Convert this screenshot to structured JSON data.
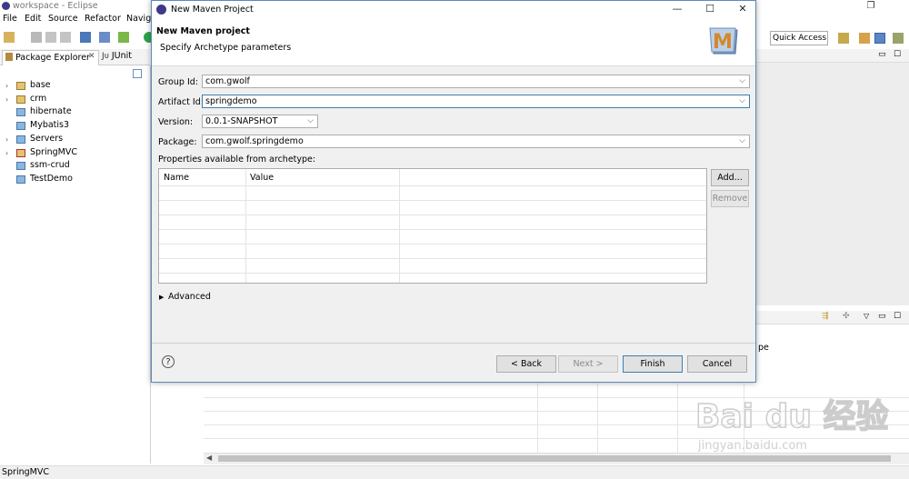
{
  "window": {
    "title": "workspace - Eclipse",
    "controls": {
      "minimize": "—",
      "restore": "❐"
    }
  },
  "menu": [
    "File",
    "Edit",
    "Source",
    "Refactor",
    "Navig"
  ],
  "quick_access": "Quick Access",
  "views": {
    "package_explorer_tab": "Package Explorer",
    "junit_tab": "JUnit",
    "tree": [
      {
        "label": "base",
        "icon": "java-project-icon",
        "expander": true
      },
      {
        "label": "crm",
        "icon": "java-project-icon",
        "expander": true
      },
      {
        "label": "hibernate",
        "icon": "folder-icon",
        "expander": false
      },
      {
        "label": "Mybatis3",
        "icon": "folder-icon",
        "expander": false
      },
      {
        "label": "Servers",
        "icon": "folder-icon",
        "expander": true
      },
      {
        "label": "SpringMVC",
        "icon": "error-project-icon",
        "expander": true
      },
      {
        "label": "ssm-crud",
        "icon": "folder-icon",
        "expander": false
      },
      {
        "label": "TestDemo",
        "icon": "folder-icon",
        "expander": false
      }
    ],
    "right_partial_text": "pe"
  },
  "status_bar": {
    "text": "SpringMVC"
  },
  "dialog": {
    "title": "New Maven Project",
    "header_title": "New Maven project",
    "header_desc": "Specify Archetype parameters",
    "fields": {
      "group_id_label": "Group Id:",
      "group_id_value": "com.gwolf",
      "artifact_id_label": "Artifact Id:",
      "artifact_id_value": "springdemo",
      "version_label": "Version:",
      "version_value": "0.0.1-SNAPSHOT",
      "package_label": "Package:",
      "package_value": "com.gwolf.springdemo"
    },
    "properties_label": "Properties available from archetype:",
    "table_headers": [
      "Name",
      "Value"
    ],
    "buttons": {
      "add": "Add...",
      "remove": "Remove",
      "back": "< Back",
      "next": "Next >",
      "finish": "Finish",
      "cancel": "Cancel"
    },
    "advanced_label": "Advanced",
    "help_symbol": "?"
  },
  "watermark": {
    "brand": "Bai du 经验",
    "url": "jingyan.baidu.com"
  }
}
